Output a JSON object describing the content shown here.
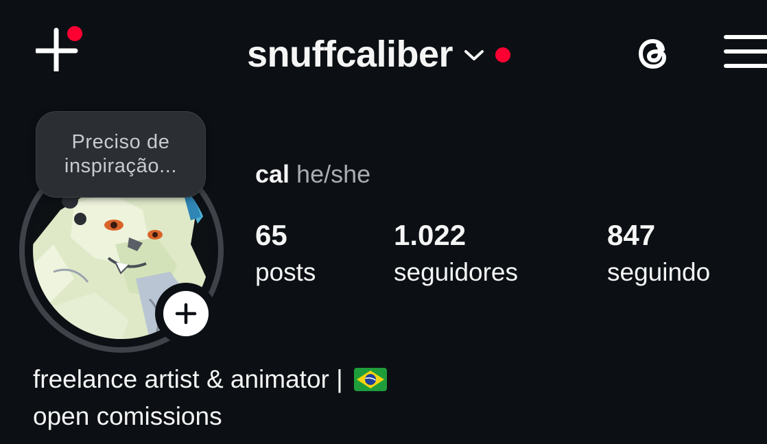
{
  "header": {
    "username": "snuffcaliber",
    "create_icon": "plus-icon",
    "threads_icon": "threads-icon",
    "menu_icon": "hamburger-menu-icon",
    "notification_color": "#ff0033"
  },
  "note": {
    "line1": "Preciso de",
    "line2": "inspiração..."
  },
  "profile": {
    "display_name": "cal",
    "pronouns": "he/she",
    "avatar_icon": "avatar",
    "add_story_icon": "plus-icon"
  },
  "stats": [
    {
      "value": "65",
      "label": "posts"
    },
    {
      "value": "1.022",
      "label": "seguidores"
    },
    {
      "value": "847",
      "label": "seguindo"
    }
  ],
  "bio": {
    "line1": "freelance artist & animator |",
    "flag_icon": "brazil-flag-icon",
    "line2": "open comissions"
  },
  "colors": {
    "background": "#0c1014",
    "text": "#f5f5f5",
    "muted": "#a8adb3",
    "bubble": "#2b2f34"
  }
}
